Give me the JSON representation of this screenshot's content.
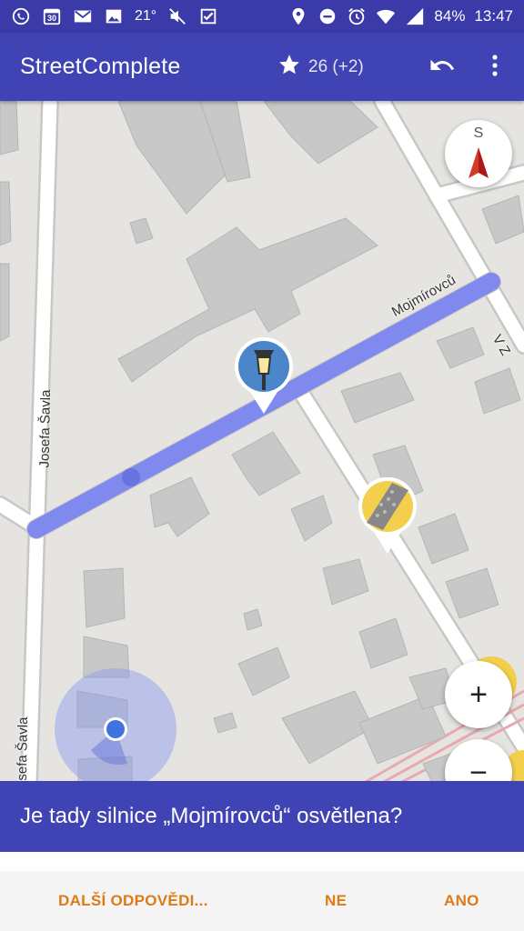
{
  "status_bar": {
    "left_icons": [
      "whatsapp-icon",
      "calendar-icon",
      "gmail-icon",
      "gallery-icon"
    ],
    "calendar_day": "30",
    "temperature": "21°",
    "right_icons": [
      "location-icon",
      "do-not-disturb-icon",
      "alarm-icon",
      "wifi-icon",
      "signal-icon"
    ],
    "battery": "84%",
    "time": "13:47"
  },
  "app_bar": {
    "title": "StreetComplete",
    "star_count": "26 (+2)",
    "undo_icon": "undo-icon",
    "menu_icon": "more-vert-icon"
  },
  "map": {
    "street_labels": {
      "mojmirovcu": "Mojmírovců",
      "josefa_savla_top": "Josefa Šavla",
      "josefa_savla_bottom": "Josefa Šavla",
      "v_z": "V Z"
    },
    "compass_letter": "S",
    "markers": [
      "street-lamp-quest-marker",
      "surface-quest-marker"
    ],
    "zoom_in": "+",
    "zoom_out": "−",
    "colors": {
      "highlight": "#7b86f0",
      "marker_blue": "#4a86c9",
      "marker_yellow": "#f3cf4c"
    }
  },
  "question": {
    "text": "Je tady silnice „Mojmírovců“ osvětlena?"
  },
  "answers": {
    "other": "DALŠÍ ODPOVĚDI...",
    "no": "NE",
    "yes": "ANO"
  },
  "colors": {
    "primary": "#3f43b4",
    "status_bar": "#3a3aa8",
    "accent": "#e07a16"
  }
}
